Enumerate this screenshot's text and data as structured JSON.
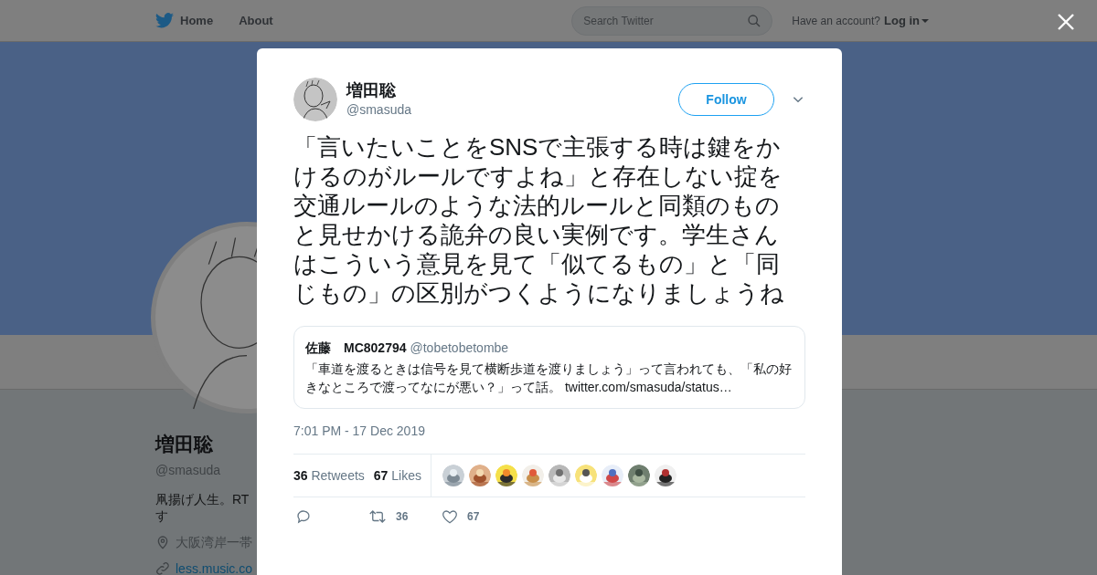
{
  "header": {
    "nav": [
      "Home",
      "About"
    ],
    "search": {
      "placeholder": "Search Twitter"
    },
    "account_prompt": "Have an account?",
    "login": "Log in"
  },
  "profile": {
    "name": "増田聡",
    "handle": "@smasuda",
    "bio": [
      "凧揚げ人生。RT",
      "す"
    ],
    "location": "大阪湾岸一帯",
    "link": "less.music.co"
  },
  "tweet": {
    "name": "増田聡",
    "handle": "@smasuda",
    "follow": "Follow",
    "text": "「言いたいことをSNSで主張する時は鍵をかけるのがルールですよね」と存在しない掟を交通ルールのような法的ルールと同類のものと見せかける詭弁の良い実例です。学生さんはこういう意見を見て「似てるもの」と「同じもの」の区別がつくようになりましょうね",
    "quote": {
      "name": "佐藤　MC802794",
      "handle": "@tobetobetombe",
      "text": "「車道を渡るときは信号を見て横断歩道を渡りましょう」って言われても、「私の好きなところで渡ってなにが悪い？」って話。",
      "link": "twitter.com/smasuda/status…"
    },
    "time": "7:01 PM - 17 Dec 2019",
    "stats": [
      {
        "count": "36",
        "label": "Retweets"
      },
      {
        "count": "67",
        "label": "Likes"
      }
    ],
    "actions": [
      {
        "kind": "reply"
      },
      {
        "kind": "retweet",
        "count": "36"
      },
      {
        "kind": "like",
        "count": "67"
      }
    ]
  }
}
